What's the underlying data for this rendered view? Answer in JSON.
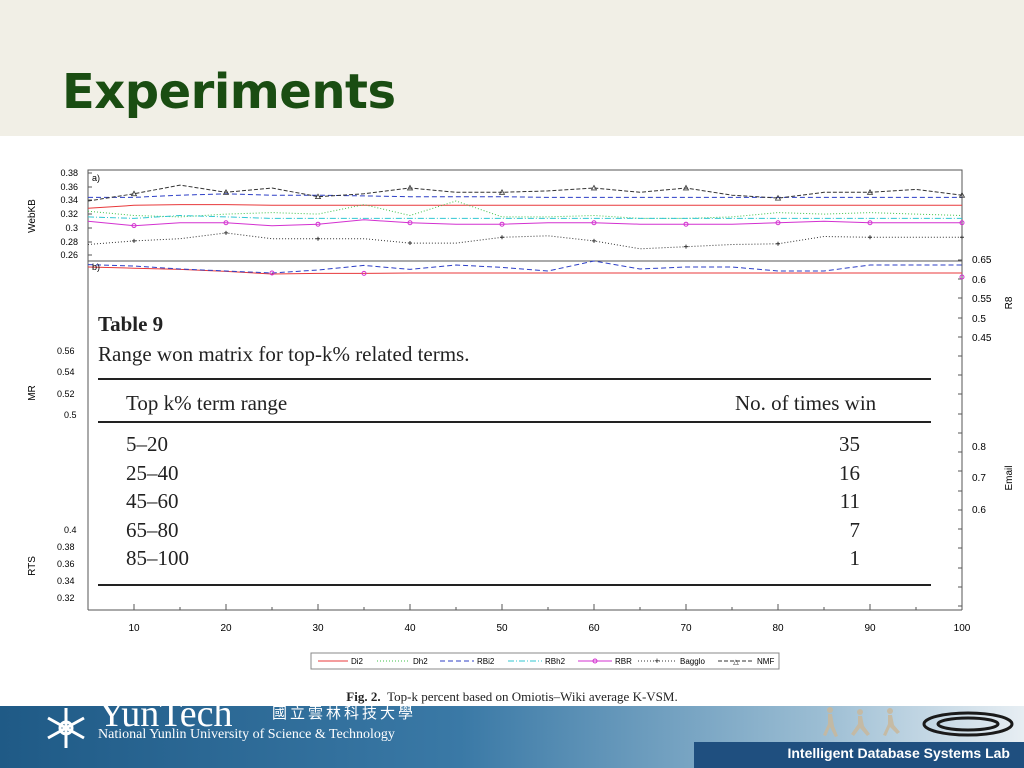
{
  "slide": {
    "title": "Experiments"
  },
  "figure": {
    "panel_a": "a)",
    "panel_b": "b)",
    "caption_label": "Fig. 2.",
    "caption_text": "Top-k percent based on Omiotis–Wiki average K-VSM.",
    "left_axes": [
      {
        "label": "WebKB",
        "ticks": [
          "0.38",
          "0.36",
          "0.34",
          "0.32",
          "0.3",
          "0.28",
          "0.26"
        ]
      },
      {
        "label": "MR",
        "ticks": [
          "0.56",
          "0.54",
          "0.52",
          "0.5"
        ]
      },
      {
        "label": "RTS",
        "ticks": [
          "0.4",
          "0.38",
          "0.36",
          "0.34",
          "0.32"
        ]
      }
    ],
    "right_axes": [
      {
        "label": "R8",
        "ticks": [
          "0.65",
          "0.6",
          "0.55",
          "0.5",
          "0.45"
        ]
      },
      {
        "label": "Email",
        "ticks": [
          "0.8",
          "0.7",
          "0.6"
        ]
      }
    ],
    "x_ticks": [
      "10",
      "20",
      "30",
      "40",
      "50",
      "60",
      "70",
      "80",
      "90",
      "100"
    ],
    "legend": [
      "Di2",
      "Dh2",
      "RBi2",
      "RBh2",
      "RBR",
      "Bagglo",
      "NMF"
    ],
    "colors": {
      "Di2": "#e8393b",
      "Dh2": "#3fc24a",
      "RBi2": "#2d3fc6",
      "RBh2": "#30c7d2",
      "RBR": "#d331d0",
      "Bagglo": "#333333",
      "NMF": "#333333"
    }
  },
  "chart_data": {
    "type": "line",
    "x": [
      5,
      10,
      15,
      20,
      25,
      30,
      35,
      40,
      45,
      50,
      55,
      60,
      65,
      70,
      75,
      80,
      85,
      90,
      95,
      100
    ],
    "xlim": [
      5,
      100
    ],
    "panels": [
      {
        "panel": "a)",
        "ylabel": "WebKB",
        "ylim": [
          0.26,
          0.38
        ],
        "series": [
          {
            "name": "Di2",
            "values": [
              0.33,
              0.334,
              0.335,
              0.335,
              0.334,
              0.334,
              0.334,
              0.334,
              0.334,
              0.334,
              0.334,
              0.334,
              0.334,
              0.334,
              0.334,
              0.334,
              0.334,
              0.334,
              0.334,
              0.334
            ]
          },
          {
            "name": "Dh2",
            "values": [
              0.326,
              0.32,
              0.318,
              0.322,
              0.324,
              0.322,
              0.335,
              0.32,
              0.34,
              0.318,
              0.318,
              0.32,
              0.316,
              0.316,
              0.318,
              0.324,
              0.322,
              0.324,
              0.322,
              0.32
            ]
          },
          {
            "name": "RBi2",
            "values": [
              0.345,
              0.345,
              0.348,
              0.35,
              0.348,
              0.348,
              0.347,
              0.346,
              0.346,
              0.346,
              0.345,
              0.345,
              0.345,
              0.345,
              0.345,
              0.345,
              0.345,
              0.345,
              0.345,
              0.345
            ]
          },
          {
            "name": "RBh2",
            "values": [
              0.318,
              0.316,
              0.32,
              0.318,
              0.316,
              0.316,
              0.316,
              0.316,
              0.316,
              0.316,
              0.316,
              0.316,
              0.316,
              0.316,
              0.316,
              0.316,
              0.316,
              0.316,
              0.316,
              0.316
            ]
          },
          {
            "name": "RBR",
            "values": [
              0.312,
              0.306,
              0.31,
              0.31,
              0.306,
              0.308,
              0.314,
              0.31,
              0.308,
              0.308,
              0.31,
              0.31,
              0.308,
              0.308,
              0.308,
              0.31,
              0.312,
              0.31,
              0.31,
              0.31
            ]
          },
          {
            "name": "Bagglo",
            "values": [
              0.28,
              0.285,
              0.288,
              0.296,
              0.288,
              0.288,
              0.288,
              0.282,
              0.282,
              0.29,
              0.292,
              0.285,
              0.274,
              0.277,
              0.28,
              0.281,
              0.291,
              0.29,
              0.29,
              0.29
            ]
          },
          {
            "name": "NMF",
            "values": [
              0.34,
              0.35,
              0.362,
              0.352,
              0.358,
              0.346,
              0.35,
              0.358,
              0.352,
              0.352,
              0.354,
              0.358,
              0.352,
              0.358,
              0.348,
              0.344,
              0.352,
              0.352,
              0.356,
              0.348
            ]
          }
        ]
      },
      {
        "panel": "b)",
        "ylabel": "R8",
        "ylim": [
          0.45,
          0.65
        ],
        "series": [
          {
            "name": "Di2",
            "values": [
              0.61,
              0.604,
              0.598,
              0.588,
              0.575,
              0.578,
              0.578,
              0.58,
              0.58,
              0.58,
              0.58,
              0.58,
              0.58,
              0.58,
              0.58,
              0.58,
              0.58,
              0.58,
              0.58,
              0.58
            ]
          },
          {
            "name": "RBi2",
            "values": [
              0.622,
              0.615,
              0.6,
              0.59,
              0.58,
              0.595,
              0.618,
              0.598,
              0.62,
              0.608,
              0.59,
              0.64,
              0.6,
              0.61,
              0.61,
              0.59,
              0.59,
              0.62,
              0.62,
              0.62
            ]
          },
          {
            "name": "RBR",
            "values": [
              null,
              null,
              null,
              null,
              0.58,
              null,
              0.578,
              null,
              null,
              null,
              null,
              null,
              null,
              null,
              null,
              null,
              null,
              null,
              null,
              0.56
            ]
          }
        ]
      }
    ]
  },
  "table": {
    "title": "Table 9",
    "description": "Range won matrix for top-k% related terms.",
    "columns": [
      "Top k% term range",
      "No. of times win"
    ],
    "rows": [
      {
        "range": "5–20",
        "wins": "35"
      },
      {
        "range": "25–40",
        "wins": "16"
      },
      {
        "range": "45–60",
        "wins": "11"
      },
      {
        "range": "65–80",
        "wins": "7"
      },
      {
        "range": "85–100",
        "wins": "1"
      }
    ]
  },
  "footer": {
    "university_big": "YunTech",
    "university_cn": "國立雲林科技大學",
    "university_en": "National Yunlin University of Science & Technology",
    "lab": "Intelligent Database Systems Lab"
  }
}
